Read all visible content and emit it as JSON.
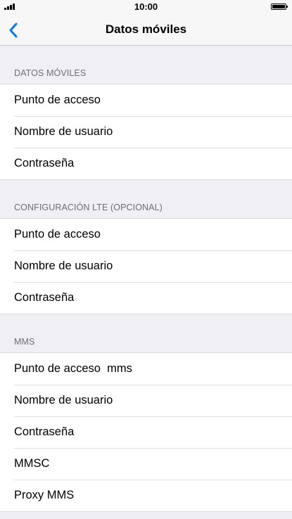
{
  "status_bar": {
    "time": "10:00",
    "signal_icon": "signal-bars-icon",
    "battery_icon": "battery-full-icon"
  },
  "nav": {
    "back_icon": "chevron-left-icon",
    "title": "Datos móviles",
    "accent_color": "#007aff"
  },
  "sections": [
    {
      "header": "DATOS MÓVILES",
      "rows": [
        {
          "label": "Punto de acceso"
        },
        {
          "label": "Nombre de usuario"
        },
        {
          "label": "Contraseña"
        }
      ]
    },
    {
      "header": "CONFIGURACIÓN LTE (OPCIONAL)",
      "rows": [
        {
          "label": "Punto de acceso"
        },
        {
          "label": "Nombre de usuario"
        },
        {
          "label": "Contraseña"
        }
      ]
    },
    {
      "header": "MMS",
      "rows": [
        {
          "label": "Punto de acceso  mms"
        },
        {
          "label": "Nombre de usuario"
        },
        {
          "label": "Contraseña"
        },
        {
          "label": "MMSC"
        },
        {
          "label": "Proxy MMS"
        }
      ]
    }
  ]
}
